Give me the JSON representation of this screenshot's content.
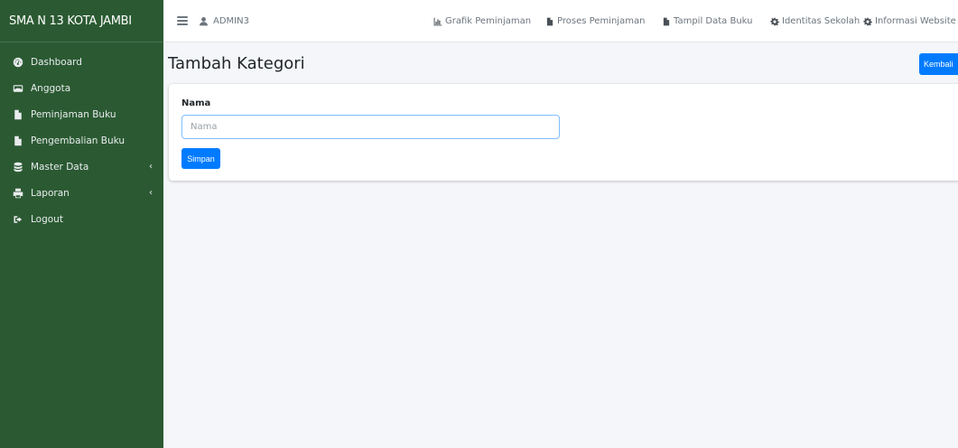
{
  "app": {
    "brand": "SMA N 13 KOTA JAMBI"
  },
  "sidebar": {
    "items": [
      {
        "label": "Dashboard",
        "icon": "dashboard-icon",
        "has_chevron": false
      },
      {
        "label": "Anggota",
        "icon": "id-card-icon",
        "has_chevron": false
      },
      {
        "label": "Peminjaman Buku",
        "icon": "file-icon",
        "has_chevron": false
      },
      {
        "label": "Pengembalian Buku",
        "icon": "file-icon",
        "has_chevron": false
      },
      {
        "label": "Master Data",
        "icon": "database-icon",
        "has_chevron": true
      },
      {
        "label": "Laporan",
        "icon": "print-icon",
        "has_chevron": true
      },
      {
        "label": "Logout",
        "icon": "sign-out-icon",
        "has_chevron": false
      }
    ]
  },
  "topbar": {
    "user": "ADMIN3",
    "links": [
      {
        "label": "Grafik Peminjaman",
        "icon": "chart-icon"
      },
      {
        "label": "Proses Peminjaman",
        "icon": "file-icon"
      },
      {
        "label": "Tampil Data Buku",
        "icon": "file-icon"
      },
      {
        "label": "Identitas Sekolah",
        "icon": "cog-icon"
      },
      {
        "label": "Informasi Website",
        "icon": "cog-icon"
      }
    ]
  },
  "main": {
    "title": "Tambah Kategori",
    "back_button": "Kembali",
    "form": {
      "field_label": "Nama",
      "field_placeholder": "Nama",
      "field_value": "",
      "submit_label": "Simpan"
    }
  },
  "colors": {
    "sidebar_bg": "#2b5a32",
    "primary": "#007bff",
    "page_bg": "#f4f6f9"
  }
}
